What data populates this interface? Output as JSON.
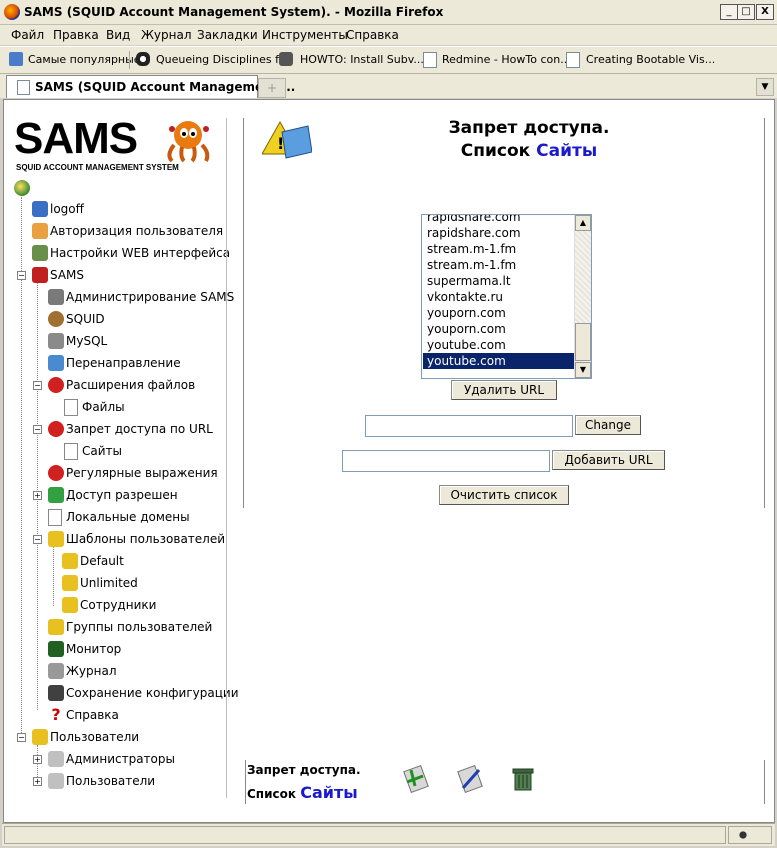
{
  "window": {
    "title": "SAMS (SQUID Account Management System). - Mozilla Firefox",
    "minimize": "_",
    "maximize": "□",
    "close": "X"
  },
  "menu": [
    "Файл",
    "Правка",
    "Вид",
    "Журнал",
    "Закладки",
    "Инструменты",
    "Справка"
  ],
  "bookmarks": [
    "Самые популярные",
    "Queueing Disciplines f...",
    "HOWTO: Install Subv...",
    "Redmine - HowTo con...",
    "Creating Bootable Vis..."
  ],
  "tabs": {
    "active": "SAMS (SQUID Account Management ...",
    "new_tab": "+"
  },
  "sidebar": {
    "logo_text": "SAMS",
    "logo_subtitle": "SQUID ACCOUNT MANAGEMENT SYSTEM",
    "items": [
      {
        "label": "logoff"
      },
      {
        "label": "Авторизация пользователя"
      },
      {
        "label": "Настройки WEB интерфейса"
      },
      {
        "label": "SAMS"
      },
      {
        "label": "Администрирование SAMS"
      },
      {
        "label": "SQUID"
      },
      {
        "label": "MySQL"
      },
      {
        "label": "Перенаправление"
      },
      {
        "label": "Расширения файлов"
      },
      {
        "label": "Файлы"
      },
      {
        "label": "Запрет доступа по URL"
      },
      {
        "label": "Сайты"
      },
      {
        "label": "Регулярные выражения"
      },
      {
        "label": "Доступ разрешен"
      },
      {
        "label": "Локальные домены"
      },
      {
        "label": "Шаблоны пользователей"
      },
      {
        "label": "Default"
      },
      {
        "label": "Unlimited"
      },
      {
        "label": "Сотрудники"
      },
      {
        "label": "Группы пользователей"
      },
      {
        "label": "Монитор"
      },
      {
        "label": "Журнал"
      },
      {
        "label": "Сохранение конфигурации"
      },
      {
        "label": "Справка"
      },
      {
        "label": "Пользователи"
      },
      {
        "label": "Администраторы"
      },
      {
        "label": "Пользователи"
      }
    ],
    "toggles": {
      "minus": "−",
      "plus": "+"
    }
  },
  "main": {
    "heading_line1": "Запрет доступа.",
    "heading_line2_prefix": "Список",
    "heading_line2_link": "Сайты",
    "url_list": [
      "rapidshare.com",
      "rapidshare.com",
      "stream.m-1.fm",
      "stream.m-1.fm",
      "supermama.lt",
      "vkontakte.ru",
      "youporn.com",
      "youporn.com",
      "youtube.com",
      "youtube.com"
    ],
    "selected_url": "youtube.com",
    "delete_button": "Удалить URL",
    "change_value": "",
    "change_button": "Change",
    "add_value": "",
    "add_button": "Добавить URL",
    "clear_button": "Очистить список"
  },
  "footer": {
    "line1": "Запрет доступа.",
    "line2_prefix": "Список",
    "line2_link": "Сайты"
  }
}
